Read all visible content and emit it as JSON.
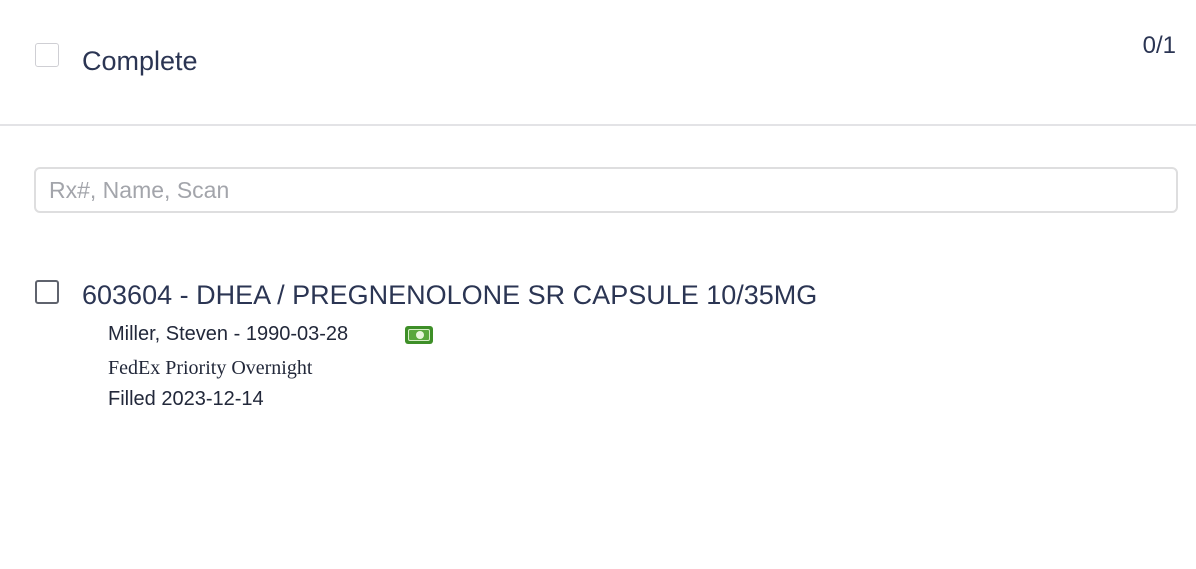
{
  "header": {
    "complete_label": "Complete",
    "complete_checked": false,
    "progress": "0/1"
  },
  "search": {
    "placeholder": "Rx#, Name, Scan",
    "value": ""
  },
  "rx_items": [
    {
      "title": "603604 - DHEA / PREGNENOLONE SR CAPSULE 10/35MG",
      "checked": false,
      "patient": "Miller, Steven - 1990-03-28",
      "payment_icon": "cash-icon",
      "shipping": "FedEx Priority Overnight",
      "filled": "Filled 2023-12-14"
    }
  ],
  "colors": {
    "text": "#2b3553",
    "divider": "#e3e3e6",
    "cash_icon": "#3e8f28"
  }
}
